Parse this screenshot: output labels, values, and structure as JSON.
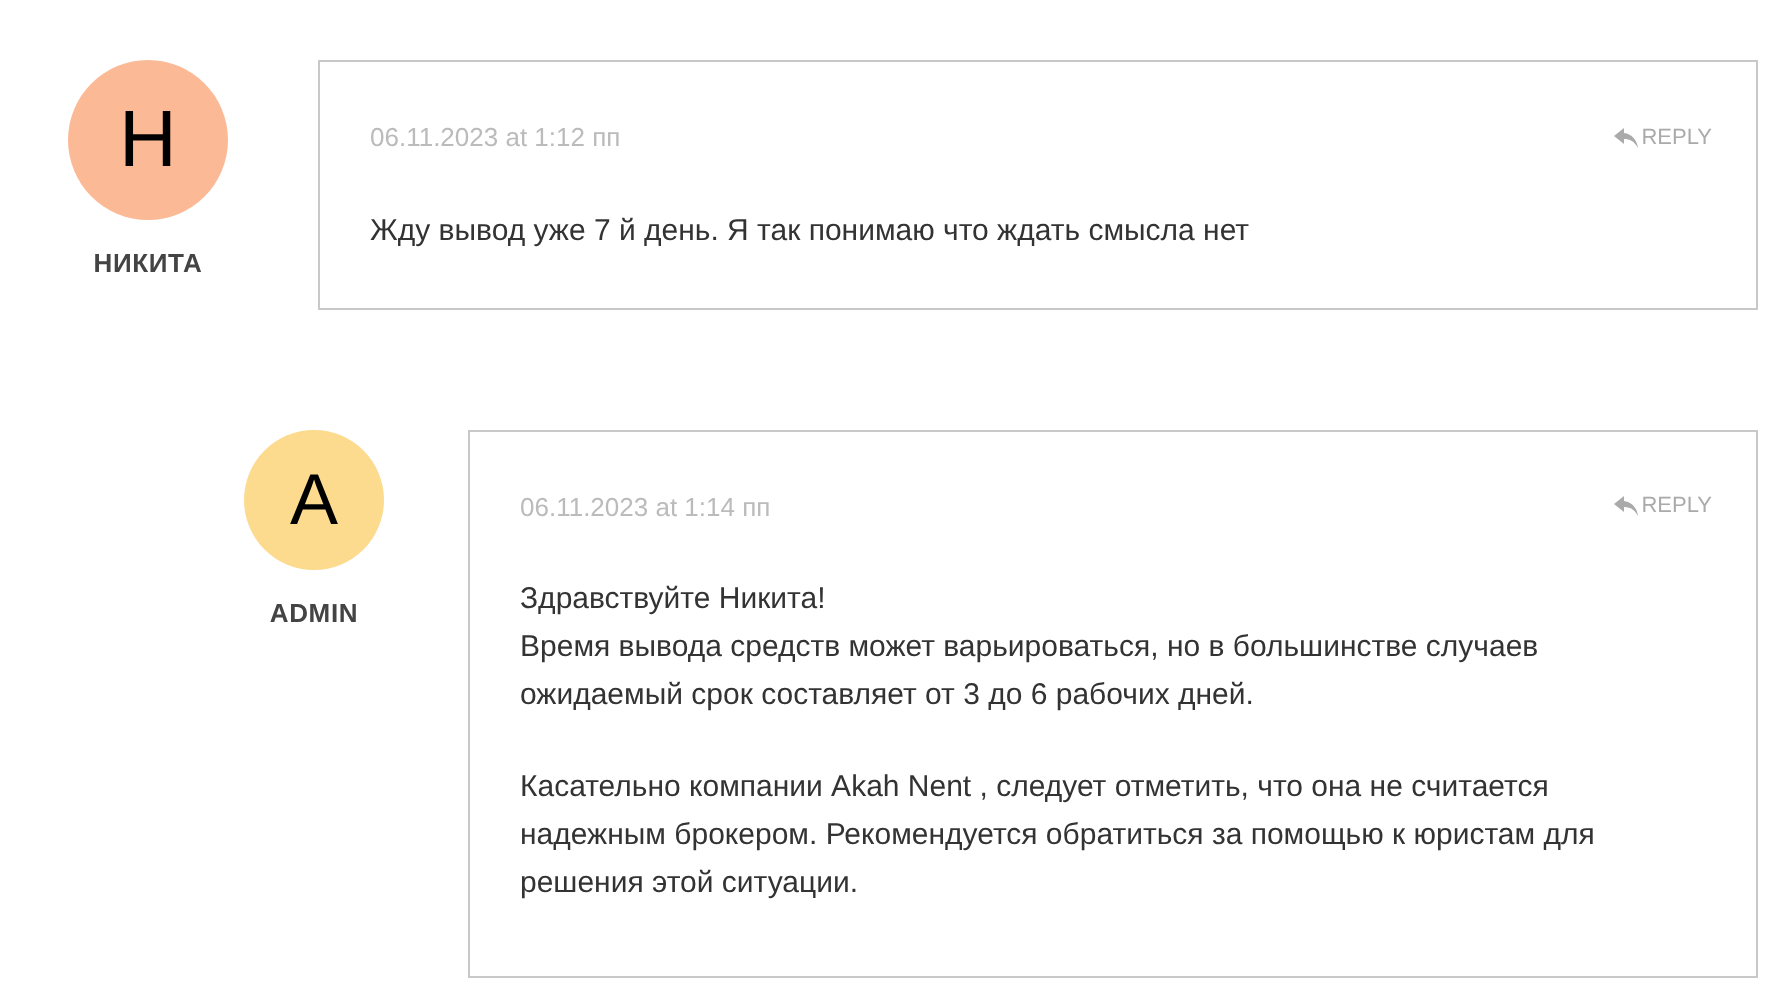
{
  "comments": [
    {
      "avatar_letter": "Н",
      "color": "#fbb995",
      "author": "НИКИТА",
      "date": "06.11.2023 at 1:12 пп",
      "reply_label": "REPLY",
      "paragraphs": [
        [
          "Жду вывод уже 7 й день. Я так понимаю что ждать смысла нет"
        ]
      ],
      "children": [
        {
          "avatar_letter": "A",
          "color": "#fcdb8f",
          "author": "ADMIN",
          "date": "06.11.2023 at 1:14 пп",
          "reply_label": "REPLY",
          "paragraphs": [
            [
              "Здравствуйте Никита!",
              "Время вывода средств может варьироваться, но в большинстве случаев ожидаемый срок составляет от 3 до 6 рабочих дней."
            ],
            [
              "Касательно компании Akah Nent , следует отметить, что она не считается надежным брокером. Рекомендуется обратиться за помощью к юристам для решения этой ситуации."
            ]
          ]
        }
      ]
    }
  ]
}
